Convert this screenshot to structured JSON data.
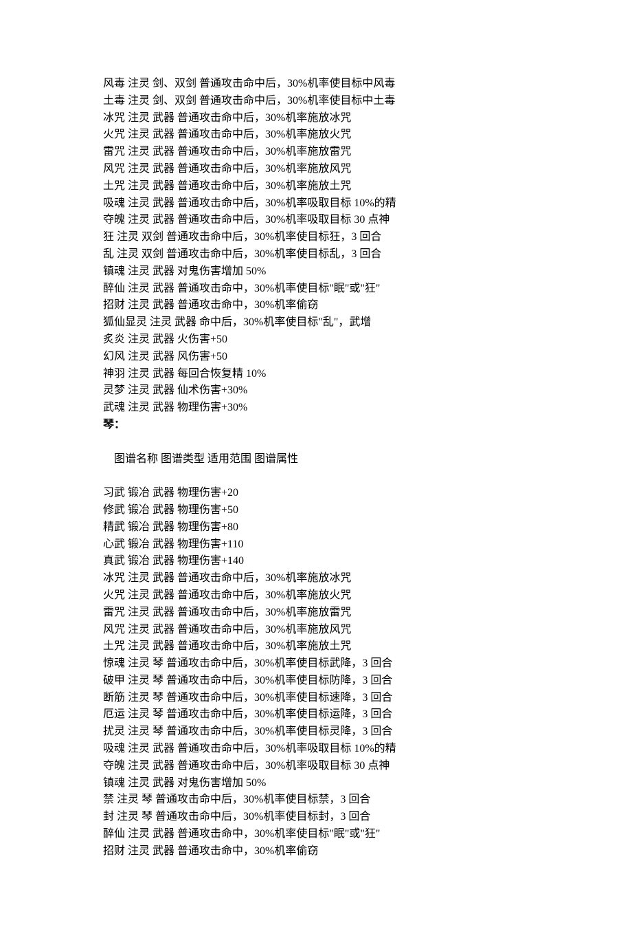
{
  "section1": {
    "rows": [
      {
        "name": "风毒",
        "type": "注灵",
        "scope": "剑、双剑",
        "attr": "普通攻击命中后，30%机率使目标中风毒"
      },
      {
        "name": "土毒",
        "type": "注灵",
        "scope": "剑、双剑",
        "attr": "普通攻击命中后，30%机率使目标中土毒"
      },
      {
        "name": "冰咒",
        "type": "注灵",
        "scope": "武器",
        "attr": "普通攻击命中后，30%机率施放冰咒"
      },
      {
        "name": "火咒",
        "type": "注灵",
        "scope": "武器",
        "attr": "普通攻击命中后，30%机率施放火咒"
      },
      {
        "name": "雷咒",
        "type": "注灵",
        "scope": "武器",
        "attr": "普通攻击命中后，30%机率施放雷咒"
      },
      {
        "name": "风咒",
        "type": "注灵",
        "scope": "武器",
        "attr": "普通攻击命中后，30%机率施放风咒"
      },
      {
        "name": "土咒",
        "type": "注灵",
        "scope": "武器",
        "attr": "普通攻击命中后，30%机率施放土咒"
      },
      {
        "name": "吸魂",
        "type": "注灵",
        "scope": "武器",
        "attr": "普通攻击命中后，30%机率吸取目标 10%的精"
      },
      {
        "name": "夺魄",
        "type": "注灵",
        "scope": "武器",
        "attr": "普通攻击命中后，30%机率吸取目标 30 点神"
      },
      {
        "name": "狂",
        "type": "注灵",
        "scope": "双剑",
        "attr": "普通攻击命中后，30%机率使目标狂，3 回合"
      },
      {
        "name": "乱",
        "type": "注灵",
        "scope": "双剑",
        "attr": "普通攻击命中后，30%机率使目标乱，3 回合"
      },
      {
        "name": "镇魂",
        "type": "注灵",
        "scope": "武器",
        "attr": "对鬼伤害增加 50%"
      },
      {
        "name": "醉仙",
        "type": "注灵",
        "scope": "武器",
        "attr": "普通攻击命中，30%机率使目标\"眠\"或\"狂\""
      },
      {
        "name": "招财",
        "type": "注灵",
        "scope": "武器",
        "attr": "普通攻击命中，30%机率偷窃"
      },
      {
        "name": "狐仙显灵",
        "type": "注灵",
        "scope": "武器",
        "attr": "命中后，30%机率使目标\"乱\"，武增"
      },
      {
        "name": "炙炎",
        "type": "注灵",
        "scope": "武器",
        "attr": "火伤害+50"
      },
      {
        "name": "幻风",
        "type": "注灵",
        "scope": "武器",
        "attr": "风伤害+50"
      },
      {
        "name": "神羽",
        "type": "注灵",
        "scope": "武器",
        "attr": "每回合恢复精 10%"
      },
      {
        "name": "灵梦",
        "type": "注灵",
        "scope": "武器",
        "attr": "仙术伤害+30%"
      },
      {
        "name": "武魂",
        "type": "注灵",
        "scope": "武器",
        "attr": "物理伤害+30%"
      }
    ]
  },
  "section2": {
    "heading": "琴：",
    "header": {
      "name": "图谱名称",
      "type": "图谱类型",
      "scope": "适用范围",
      "attr": "图谱属性"
    },
    "rows": [
      {
        "name": "习武",
        "type": "锻冶",
        "scope": "武器",
        "attr": "物理伤害+20"
      },
      {
        "name": "修武",
        "type": "锻冶",
        "scope": "武器",
        "attr": "物理伤害+50"
      },
      {
        "name": "精武",
        "type": "锻冶",
        "scope": "武器",
        "attr": "物理伤害+80"
      },
      {
        "name": "心武",
        "type": "锻冶",
        "scope": "武器",
        "attr": "物理伤害+110"
      },
      {
        "name": "真武",
        "type": "锻冶",
        "scope": "武器",
        "attr": "物理伤害+140"
      },
      {
        "name": "冰咒",
        "type": "注灵",
        "scope": "武器",
        "attr": "普通攻击命中后，30%机率施放冰咒"
      },
      {
        "name": "火咒",
        "type": "注灵",
        "scope": "武器",
        "attr": "普通攻击命中后，30%机率施放火咒"
      },
      {
        "name": "雷咒",
        "type": "注灵",
        "scope": "武器",
        "attr": "普通攻击命中后，30%机率施放雷咒"
      },
      {
        "name": "风咒",
        "type": "注灵",
        "scope": "武器",
        "attr": "普通攻击命中后，30%机率施放风咒"
      },
      {
        "name": "土咒",
        "type": "注灵",
        "scope": "武器",
        "attr": "普通攻击命中后，30%机率施放土咒"
      },
      {
        "name": "惊魂",
        "type": "注灵",
        "scope": "琴",
        "attr": "普通攻击命中后，30%机率使目标武降，3 回合"
      },
      {
        "name": "破甲",
        "type": "注灵",
        "scope": "琴",
        "attr": "普通攻击命中后，30%机率使目标防降，3 回合"
      },
      {
        "name": "断筋",
        "type": "注灵",
        "scope": "琴",
        "attr": "普通攻击命中后，30%机率使目标速降，3 回合"
      },
      {
        "name": "厄运",
        "type": "注灵",
        "scope": "琴",
        "attr": "普通攻击命中后，30%机率使目标运降，3 回合"
      },
      {
        "name": "扰灵",
        "type": "注灵",
        "scope": "琴",
        "attr": "普通攻击命中后，30%机率使目标灵降，3 回合"
      },
      {
        "name": "吸魂",
        "type": "注灵",
        "scope": "武器",
        "attr": "普通攻击命中后，30%机率吸取目标 10%的精"
      },
      {
        "name": "夺魄",
        "type": "注灵",
        "scope": "武器",
        "attr": "普通攻击命中后，30%机率吸取目标 30 点神"
      },
      {
        "name": "镇魂",
        "type": "注灵",
        "scope": "武器",
        "attr": "对鬼伤害增加 50%"
      },
      {
        "name": "禁",
        "type": "注灵",
        "scope": "琴",
        "attr": "普通攻击命中后，30%机率使目标禁，3 回合"
      },
      {
        "name": "封",
        "type": "注灵",
        "scope": "琴",
        "attr": "普通攻击命中后，30%机率使目标封，3 回合"
      },
      {
        "name": "醉仙",
        "type": "注灵",
        "scope": "武器",
        "attr": "普通攻击命中，30%机率使目标\"眠\"或\"狂\""
      },
      {
        "name": "招财",
        "type": "注灵",
        "scope": "武器",
        "attr": "普通攻击命中，30%机率偷窃"
      }
    ]
  }
}
